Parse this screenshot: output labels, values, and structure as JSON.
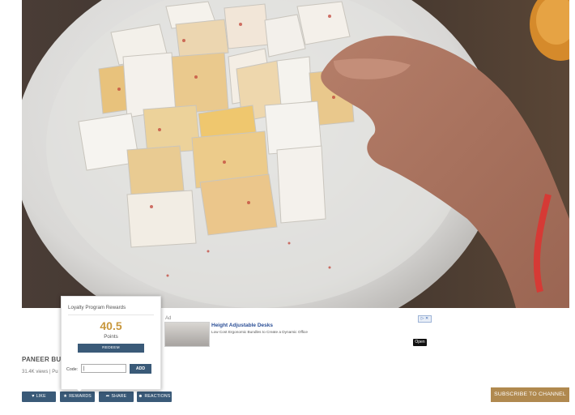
{
  "video": {
    "title": "PANEER BUT",
    "meta": "31.4K views | Pu"
  },
  "ad": {
    "label": "Ad",
    "title": "Height Adjustable Desks",
    "description": "Low Cost Ergonomic Bundles to Create a Dynamic Office",
    "choice_label": "▷ ✕",
    "open_label": "Open"
  },
  "popup": {
    "title": "Loyalty Program Rewards",
    "points_value": "40.5",
    "points_label": "Points",
    "redeem_label": "REDEEM",
    "code_label": "Code:",
    "code_value": "|",
    "add_label": "ADD"
  },
  "actions": {
    "like": {
      "icon": "♥",
      "label": "LIKE"
    },
    "rewards": {
      "icon": "★",
      "label": "REWARDS"
    },
    "share": {
      "icon": "➦",
      "label": "SHARE"
    },
    "reactions": {
      "icon": "☻",
      "label": "REACTIONS"
    }
  },
  "subscribe_label": "SUBSCRIBE TO CHANNEL",
  "colors": {
    "button_bg": "#3a5a78",
    "subscribe_bg": "#b0894f",
    "points_accent": "#c8973c"
  }
}
